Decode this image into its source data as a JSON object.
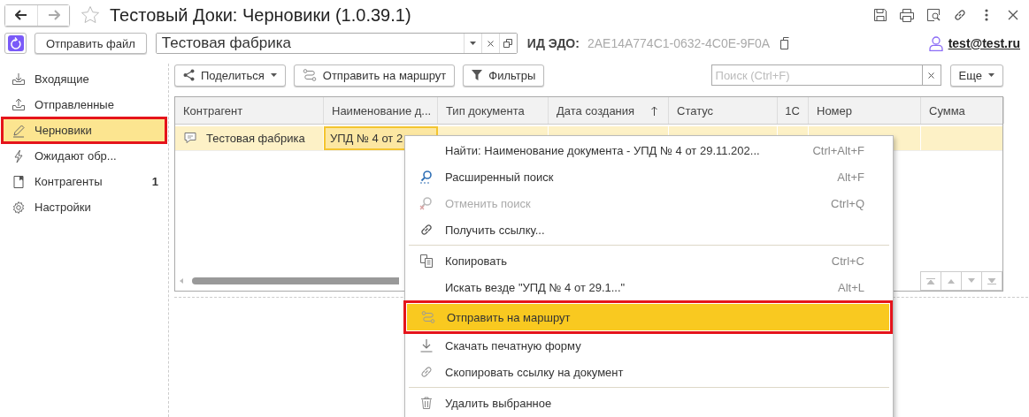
{
  "window": {
    "title": "Тестовый Доки: Черновики (1.0.39.1)"
  },
  "toolbar": {
    "send_file": "Отправить файл",
    "org_field": {
      "value": "Тестовая фабрика"
    },
    "edo_label": "ИД ЭДО:",
    "edo_id": "2AE14A774C1-0632-4C0E-9F0A",
    "user": "test@test.ru"
  },
  "sidebar": {
    "items": [
      {
        "label": "Входящие",
        "selected": false,
        "outlined": false
      },
      {
        "label": "Отправленные",
        "selected": false,
        "outlined": false
      },
      {
        "label": "Черновики",
        "selected": true,
        "outlined": true
      },
      {
        "label": "Ожидают обр...",
        "selected": false,
        "outlined": false
      },
      {
        "label": "Контрагенты",
        "count": "1",
        "selected": false,
        "outlined": false
      },
      {
        "label": "Настройки",
        "selected": false,
        "outlined": false
      }
    ]
  },
  "commands": {
    "share": "Поделиться",
    "route": "Отправить на маршрут",
    "filters": "Фильтры",
    "search": {
      "placeholder": "Поиск (Ctrl+F)"
    },
    "more": "Еще"
  },
  "table": {
    "columns": [
      {
        "label": "Контрагент",
        "sorted": false
      },
      {
        "label": "Наименование д...",
        "sorted": false
      },
      {
        "label": "Тип документа",
        "sorted": false
      },
      {
        "label": "Дата создания",
        "sorted": true
      },
      {
        "label": "Статус",
        "sorted": false
      },
      {
        "label": "1С",
        "sorted": false
      },
      {
        "label": "Номер",
        "sorted": false
      },
      {
        "label": "Сумма",
        "sorted": false
      }
    ],
    "rows": [
      {
        "cells": [
          "Тестовая фабрика",
          "УПД № 4 от 2"
        ],
        "selected": true
      }
    ]
  },
  "context_menu": {
    "items": [
      {
        "kind": "item",
        "label": "Найти: Наименование документа - УПД № 4 от 29.11.202...",
        "shortcut": "Ctrl+Alt+F",
        "disabled": false,
        "selected": false,
        "outlined": false
      },
      {
        "kind": "item",
        "label": "Расширенный поиск",
        "shortcut": "Alt+F",
        "disabled": false,
        "selected": false,
        "outlined": false
      },
      {
        "kind": "item",
        "label": "Отменить поиск",
        "shortcut": "Ctrl+Q",
        "disabled": true,
        "selected": false,
        "outlined": false
      },
      {
        "kind": "item",
        "label": "Получить ссылку...",
        "disabled": false,
        "selected": false,
        "outlined": false
      },
      {
        "kind": "separator"
      },
      {
        "kind": "item",
        "label": "Копировать",
        "shortcut": "Ctrl+C",
        "disabled": false,
        "selected": false,
        "outlined": false
      },
      {
        "kind": "item",
        "label": "Искать везде \"УПД № 4 от 29.1...\"",
        "shortcut": "Alt+L",
        "disabled": false,
        "selected": false,
        "outlined": false
      },
      {
        "kind": "item",
        "label": "Отправить на маршрут",
        "disabled": false,
        "selected": true,
        "outlined": true
      },
      {
        "kind": "item",
        "label": "Скачать печатную форму",
        "disabled": false,
        "selected": false,
        "outlined": false
      },
      {
        "kind": "item",
        "label": "Скопировать ссылку на документ",
        "disabled": false,
        "selected": false,
        "outlined": false
      },
      {
        "kind": "separator"
      },
      {
        "kind": "item",
        "label": "Удалить выбранное",
        "disabled": false,
        "selected": false,
        "outlined": false
      }
    ]
  }
}
